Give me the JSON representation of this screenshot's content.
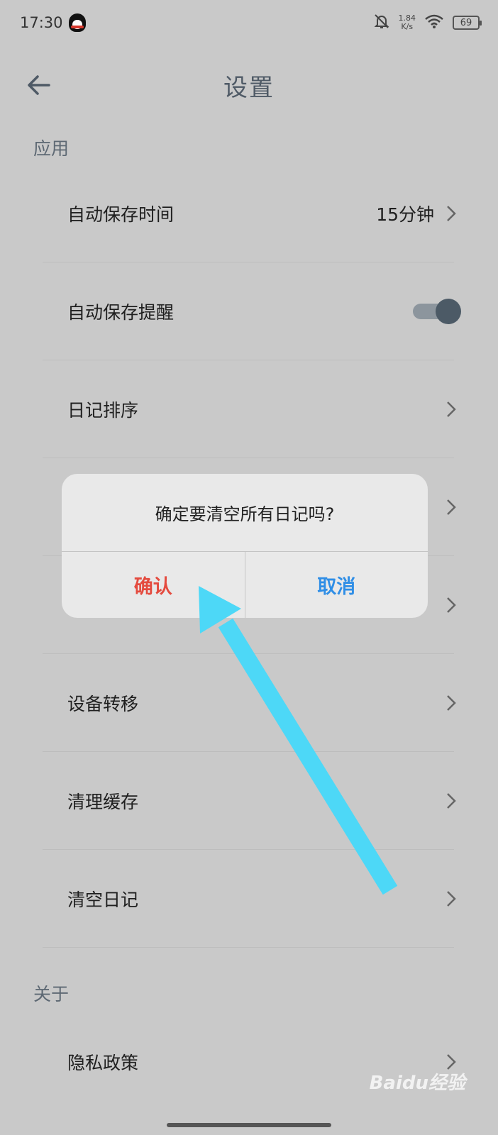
{
  "status_bar": {
    "time": "17:30",
    "speed_value": "1.84",
    "speed_unit": "K/s",
    "battery": "69"
  },
  "header": {
    "title": "设置"
  },
  "sections": {
    "app": "应用",
    "about": "关于"
  },
  "rows": {
    "autosave_time": {
      "label": "自动保存时间",
      "value": "15分钟"
    },
    "autosave_reminder": {
      "label": "自动保存提醒",
      "enabled": true
    },
    "diary_sort": {
      "label": "日记排序"
    },
    "device_transfer": {
      "label": "设备转移"
    },
    "clear_cache": {
      "label": "清理缓存"
    },
    "clear_diary": {
      "label": "清空日记"
    },
    "privacy_policy": {
      "label": "隐私政策"
    }
  },
  "dialog": {
    "message": "确定要清空所有日记吗?",
    "confirm": "确认",
    "cancel": "取消"
  },
  "watermark": "Baidu经验",
  "colors": {
    "background": "#c9c9c9",
    "confirm": "#e44b3f",
    "cancel": "#2f8ee6",
    "arrow": "#4dd8f7",
    "toggle": "#4c5a66"
  }
}
